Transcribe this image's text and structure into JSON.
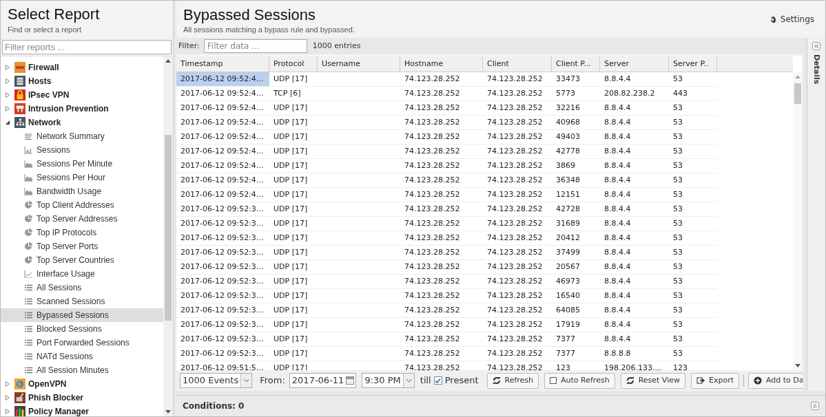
{
  "sidebar": {
    "title": "Select Report",
    "subtitle": "Find or select a report",
    "filter_placeholder": "Filter reports ...",
    "tree": [
      {
        "label": "Firewall",
        "expanded": false
      },
      {
        "label": "Hosts",
        "expanded": false
      },
      {
        "label": "IPsec VPN",
        "expanded": false
      },
      {
        "label": "Intrusion Prevention",
        "expanded": false
      },
      {
        "label": "Network",
        "expanded": true,
        "children": [
          {
            "label": "Network Summary",
            "kind": "text",
            "selected": false
          },
          {
            "label": "Sessions",
            "kind": "bar",
            "selected": false
          },
          {
            "label": "Sessions Per Minute",
            "kind": "area",
            "selected": false
          },
          {
            "label": "Sessions Per Hour",
            "kind": "area",
            "selected": false
          },
          {
            "label": "Bandwidth Usage",
            "kind": "area",
            "selected": false
          },
          {
            "label": "Top Client Addresses",
            "kind": "pie",
            "selected": false
          },
          {
            "label": "Top Server Addresses",
            "kind": "pie",
            "selected": false
          },
          {
            "label": "Top IP Protocols",
            "kind": "pie",
            "selected": false
          },
          {
            "label": "Top Server Ports",
            "kind": "pie",
            "selected": false
          },
          {
            "label": "Top Server Countries",
            "kind": "pie",
            "selected": false
          },
          {
            "label": "Interface Usage",
            "kind": "line",
            "selected": false
          },
          {
            "label": "All Sessions",
            "kind": "list",
            "selected": false
          },
          {
            "label": "Scanned Sessions",
            "kind": "list",
            "selected": false
          },
          {
            "label": "Bypassed Sessions",
            "kind": "list",
            "selected": true
          },
          {
            "label": "Blocked Sessions",
            "kind": "list",
            "selected": false
          },
          {
            "label": "Port Forwarded Sessions",
            "kind": "list",
            "selected": false
          },
          {
            "label": "NATd Sessions",
            "kind": "list",
            "selected": false
          },
          {
            "label": "All Session Minutes",
            "kind": "list",
            "selected": false
          }
        ]
      },
      {
        "label": "OpenVPN",
        "expanded": false
      },
      {
        "label": "Phish Blocker",
        "expanded": false
      },
      {
        "label": "Policy Manager",
        "expanded": false
      }
    ]
  },
  "report": {
    "title": "Bypassed Sessions",
    "description": "All sessions matching a bypass rule and bypassed.",
    "settings": "Settings"
  },
  "filter": {
    "label": "Filter:",
    "placeholder": "Filter data ...",
    "count": "1000 entries"
  },
  "table": {
    "columns": [
      "Timestamp",
      "Protocol",
      "Username",
      "Hostname",
      "Client",
      "Client P...",
      "Server",
      "Server P.."
    ],
    "rows": [
      {
        "cells": [
          "2017-06-12 09:52:4...",
          "UDP [17]",
          "",
          "74.123.28.252",
          "74.123.28.252",
          "33473",
          "8.8.4.4",
          "53"
        ],
        "selected": true
      },
      {
        "cells": [
          "2017-06-12 09:52:4...",
          "TCP [6]",
          "",
          "74.123.28.252",
          "74.123.28.252",
          "5773",
          "208.82.238.2",
          "443"
        ],
        "selected": false
      },
      {
        "cells": [
          "2017-06-12 09:52:4...",
          "UDP [17]",
          "",
          "74.123.28.252",
          "74.123.28.252",
          "32216",
          "8.8.4.4",
          "53"
        ],
        "selected": false
      },
      {
        "cells": [
          "2017-06-12 09:52:4...",
          "UDP [17]",
          "",
          "74.123.28.252",
          "74.123.28.252",
          "40968",
          "8.8.4.4",
          "53"
        ],
        "selected": false
      },
      {
        "cells": [
          "2017-06-12 09:52:4...",
          "UDP [17]",
          "",
          "74.123.28.252",
          "74.123.28.252",
          "49403",
          "8.8.4.4",
          "53"
        ],
        "selected": false
      },
      {
        "cells": [
          "2017-06-12 09:52:4...",
          "UDP [17]",
          "",
          "74.123.28.252",
          "74.123.28.252",
          "42778",
          "8.8.4.4",
          "53"
        ],
        "selected": false
      },
      {
        "cells": [
          "2017-06-12 09:52:4...",
          "UDP [17]",
          "",
          "74.123.28.252",
          "74.123.28.252",
          "3869",
          "8.8.4.4",
          "53"
        ],
        "selected": false
      },
      {
        "cells": [
          "2017-06-12 09:52:4...",
          "UDP [17]",
          "",
          "74.123.28.252",
          "74.123.28.252",
          "36348",
          "8.8.4.4",
          "53"
        ],
        "selected": false
      },
      {
        "cells": [
          "2017-06-12 09:52:4...",
          "UDP [17]",
          "",
          "74.123.28.252",
          "74.123.28.252",
          "12151",
          "8.8.4.4",
          "53"
        ],
        "selected": false
      },
      {
        "cells": [
          "2017-06-12 09:52:3...",
          "UDP [17]",
          "",
          "74.123.28.252",
          "74.123.28.252",
          "42728",
          "8.8.4.4",
          "53"
        ],
        "selected": false
      },
      {
        "cells": [
          "2017-06-12 09:52:3...",
          "UDP [17]",
          "",
          "74.123.28.252",
          "74.123.28.252",
          "31689",
          "8.8.4.4",
          "53"
        ],
        "selected": false
      },
      {
        "cells": [
          "2017-06-12 09:52:3...",
          "UDP [17]",
          "",
          "74.123.28.252",
          "74.123.28.252",
          "20412",
          "8.8.4.4",
          "53"
        ],
        "selected": false
      },
      {
        "cells": [
          "2017-06-12 09:52:3...",
          "UDP [17]",
          "",
          "74.123.28.252",
          "74.123.28.252",
          "37499",
          "8.8.4.4",
          "53"
        ],
        "selected": false
      },
      {
        "cells": [
          "2017-06-12 09:52:3...",
          "UDP [17]",
          "",
          "74.123.28.252",
          "74.123.28.252",
          "20567",
          "8.8.4.4",
          "53"
        ],
        "selected": false
      },
      {
        "cells": [
          "2017-06-12 09:52:3...",
          "UDP [17]",
          "",
          "74.123.28.252",
          "74.123.28.252",
          "46973",
          "8.8.4.4",
          "53"
        ],
        "selected": false
      },
      {
        "cells": [
          "2017-06-12 09:52:3...",
          "UDP [17]",
          "",
          "74.123.28.252",
          "74.123.28.252",
          "16540",
          "8.8.4.4",
          "53"
        ],
        "selected": false
      },
      {
        "cells": [
          "2017-06-12 09:52:3...",
          "UDP [17]",
          "",
          "74.123.28.252",
          "74.123.28.252",
          "64085",
          "8.8.4.4",
          "53"
        ],
        "selected": false
      },
      {
        "cells": [
          "2017-06-12 09:52:3...",
          "UDP [17]",
          "",
          "74.123.28.252",
          "74.123.28.252",
          "17919",
          "8.8.4.4",
          "53"
        ],
        "selected": false
      },
      {
        "cells": [
          "2017-06-12 09:52:3...",
          "UDP [17]",
          "",
          "74.123.28.252",
          "74.123.28.252",
          "7377",
          "8.8.4.4",
          "53"
        ],
        "selected": false
      },
      {
        "cells": [
          "2017-06-12 09:52:3...",
          "UDP [17]",
          "",
          "74.123.28.252",
          "74.123.28.252",
          "7377",
          "8.8.8.8",
          "53"
        ],
        "selected": false
      },
      {
        "cells": [
          "2017-06-12 09:51:5...",
          "UDP [17]",
          "",
          "74.123.28.252",
          "74.123.28.252",
          "123",
          "198.206.133....",
          "123"
        ],
        "selected": false
      }
    ]
  },
  "details_panel": {
    "label": "Details"
  },
  "toolbar": {
    "limit": "1000 Events",
    "from_label": "From:",
    "from_date": "2017-06-11",
    "from_time": "9:30 PM",
    "till_label": "till",
    "present": {
      "label": "Present",
      "checked": true
    },
    "buttons": [
      {
        "label": "Refresh",
        "kind": "refresh"
      },
      {
        "label": "Auto Refresh",
        "kind": "toggle",
        "checked": false
      },
      {
        "label": "Reset View",
        "kind": "refresh"
      },
      {
        "label": "Export",
        "kind": "export"
      },
      {
        "label": "Add to Da",
        "kind": "add"
      }
    ]
  },
  "conditions": {
    "label": "Conditions: 0"
  }
}
